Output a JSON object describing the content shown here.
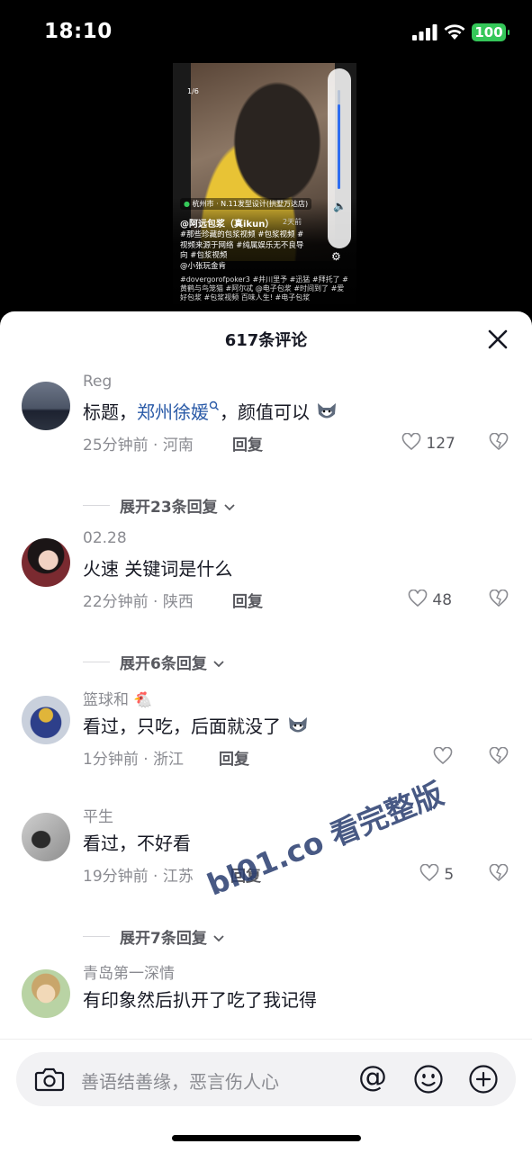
{
  "status_bar": {
    "time": "18:10",
    "battery": "100"
  },
  "video": {
    "page_indicator": "1/6",
    "location": "杭州市 · N.11发型设计(拱墅万达店)",
    "author": "@阿远包浆（真ikun）",
    "posted": "2天前",
    "description": "#那些珍藏的包浆视频 #包浆视频 #视频来源于网络 #纯属娱乐无不良导向 #包浆视频",
    "mention": "@小张玩金肯",
    "extra_tags": "#dovergorofpoker3 #井川里予 #迅猛 #拜托了 #黄鹤与鸟笼猫 #阿尔忒 @电子包浆 #时间到了 #爱好包浆 #包浆视频 百味人生! #电子包浆"
  },
  "sheet": {
    "title": "617条评论"
  },
  "comments": [
    {
      "user": "Reg",
      "text_pre": "标题，",
      "text_link": "郑州徐媛",
      "text_post": "，颜值可以",
      "time_loc": "25分钟前 · 河南",
      "reply": "回复",
      "likes": "127"
    },
    {
      "user": "02.28",
      "text": "火速 关键词是什么",
      "time_loc": "22分钟前 · 陕西",
      "reply": "回复",
      "likes": "48"
    },
    {
      "user": "篮球和",
      "text": "看过，只吃，后面就没了",
      "time_loc": "1分钟前 · 浙江",
      "reply": "回复",
      "likes": ""
    },
    {
      "user": "平生",
      "text": "看过，不好看",
      "time_loc": "19分钟前 · 江苏",
      "reply": "回复",
      "likes": "5"
    },
    {
      "user": "青岛第一深情",
      "text": "有印象然后扒开了吃了我记得"
    }
  ],
  "expand": [
    "展开23条回复",
    "展开6条回复",
    "展开7条回复"
  ],
  "watermark": "bl01.co 看完整版",
  "input": {
    "placeholder": "善语结善缘，恶言伤人心"
  },
  "colors": {
    "accent_link": "#2a5aa7",
    "battery": "#35c759",
    "volume": "#2f6df0"
  }
}
